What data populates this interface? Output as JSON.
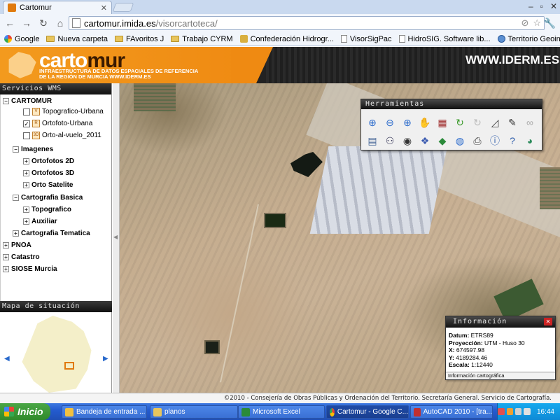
{
  "browser": {
    "tab_title": "Cartomur",
    "address_host": "cartomur.imida.es",
    "address_path": "/visorcartoteca/",
    "bookmarks": [
      {
        "label": "Google",
        "icon": "google-icon"
      },
      {
        "label": "Nueva carpeta",
        "icon": "folder-icon"
      },
      {
        "label": "FAvoritos J",
        "icon": "folder-icon"
      },
      {
        "label": "Trabajo CYRM",
        "icon": "folder-icon"
      },
      {
        "label": "Confederación Hidrogr...",
        "icon": "chg-icon"
      },
      {
        "label": "VisorSigPac",
        "icon": "page-icon"
      },
      {
        "label": "HidroSIG. Software lib...",
        "icon": "page-icon"
      },
      {
        "label": "Territorio Geoinnova –...",
        "icon": "globe-icon"
      }
    ]
  },
  "banner": {
    "logo_a": "carto",
    "logo_b": "mur",
    "subtitle_1": "INFRAESTRUCTURA DE DATOS ESPACIALES DE REFERENCIA",
    "subtitle_2": "DE LA REGIÓN DE MURCIA   WWW.IDERM.ES",
    "site_url": "WWW.IDERM.ES"
  },
  "left_panel": {
    "wms_title": "Servicios WMS",
    "tree": {
      "cartomur": "CARTOMUR",
      "topografico_urbana": "Topografico-Urbana",
      "ortofoto_urbana": "Ortofoto-Urbana",
      "orto_al_vuelo": "Orto-al-vuelo_2011",
      "imagenes": "Imagenes",
      "ortofotos_2d": "Ortofotos 2D",
      "ortofotos_3d": "Ortofotos 3D",
      "orto_satelite": "Orto Satelite",
      "cartografia_basica": "Cartografia Basica",
      "topografico": "Topografico",
      "auxiliar": "Auxiliar",
      "cartografia_tematica": "Cartografia Tematica",
      "pnoa": "PNOA",
      "catastro": "Catastro",
      "siose": "SIOSE Murcia"
    },
    "situation_title": "Mapa de situación"
  },
  "tools_panel": {
    "title": "Herramientas",
    "tools": [
      "zoom-box-icon",
      "zoom-out-icon",
      "zoom-in-icon",
      "pan-icon",
      "grid-icon",
      "refresh-icon",
      "refresh-disabled-icon",
      "measure-icon",
      "clear-icon",
      "link-icon",
      "print-preview-icon",
      "binoculars-icon",
      "eye-icon",
      "layers-icon",
      "green-layer-icon",
      "globe-arrow-icon",
      "printer-icon",
      "info-icon",
      "help-icon",
      "world-icon"
    ]
  },
  "info_panel": {
    "title": "Información",
    "datum_label": "Datum:",
    "datum": "ETRS89",
    "proj_label": "Proyección:",
    "proj": "UTM - Huso 30",
    "x_label": "X:",
    "x": "674597.98",
    "y_label": "Y:",
    "y": "4189284.46",
    "scale_label": "Escala:",
    "scale": "1:12440",
    "footer": "Información cartográfica"
  },
  "footer_text": "©2010 - Consejería de Obras Públicas y Ordenación del Territorio. Secretaría General. Servicio de Cartografía.",
  "taskbar": {
    "start": "Inicio",
    "items": [
      {
        "label": "Bandeja de entrada ..."
      },
      {
        "label": "planos"
      },
      {
        "label": "Microsoft Excel"
      },
      {
        "label": "Cartomur - Google C..."
      },
      {
        "label": "AutoCAD 2010 - [tra..."
      }
    ],
    "clock": "16:44"
  }
}
